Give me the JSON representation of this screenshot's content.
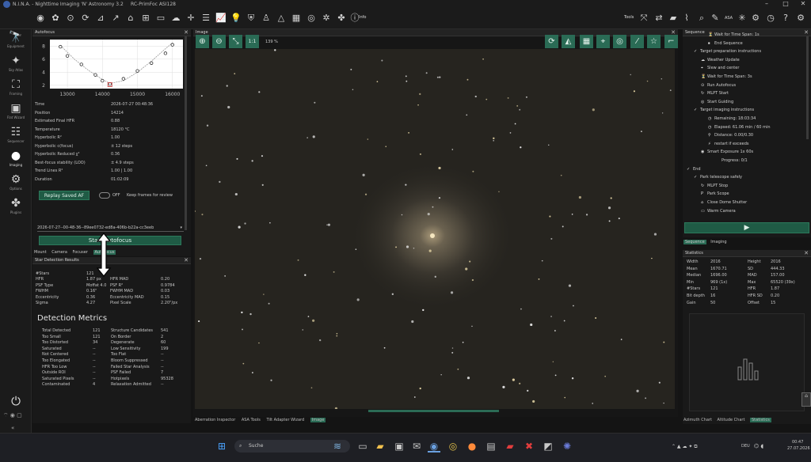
{
  "title": {
    "app": "N.I.N.A. - Nighttime Imaging 'N' Astronomy 3.2",
    "profile": "RC-PrimFoc ASI128"
  },
  "toolbar": {
    "info_label": "Info",
    "tools_label": "Tools"
  },
  "sidebar": {
    "items": [
      {
        "label": "Equipment"
      },
      {
        "label": "Sky Atlas"
      },
      {
        "label": "Framing"
      },
      {
        "label": "Flat Wizard"
      },
      {
        "label": "Sequencer"
      },
      {
        "label": "Imaging"
      },
      {
        "label": "Options"
      },
      {
        "label": "Plugins"
      }
    ]
  },
  "autofocus": {
    "title": "Autofocus",
    "chart": {
      "x_ticks": [
        "13000",
        "14000",
        "15000",
        "16000"
      ],
      "y_ticks": [
        "8",
        "6",
        "4",
        "2"
      ],
      "points": [
        [
          12800,
          7.9
        ],
        [
          13000,
          6.5
        ],
        [
          13400,
          5.2
        ],
        [
          13800,
          3.6
        ],
        [
          14000,
          2.7
        ],
        [
          14214,
          2.2
        ],
        [
          14600,
          3.0
        ],
        [
          15000,
          4.2
        ],
        [
          15400,
          5.4
        ],
        [
          15800,
          6.9
        ],
        [
          16000,
          8.2
        ]
      ],
      "curve": [
        [
          12800,
          8.1
        ],
        [
          13200,
          6.0
        ],
        [
          13600,
          4.3
        ],
        [
          14000,
          2.9
        ],
        [
          14214,
          2.3
        ],
        [
          14600,
          2.7
        ],
        [
          15000,
          4.0
        ],
        [
          15400,
          5.7
        ],
        [
          15800,
          7.6
        ],
        [
          16000,
          8.5
        ]
      ],
      "min_point": [
        14214,
        2.1
      ],
      "xlim": [
        12500,
        16300
      ],
      "ylim": [
        1.5,
        9
      ]
    },
    "details": [
      {
        "label": "Time",
        "value": "2026-07-27 00:48:36"
      },
      {
        "label": "Position",
        "value": "14214"
      },
      {
        "label": "Estimated Final HFR",
        "value": "0.88"
      },
      {
        "label": "Temperature",
        "value": "18120 °C"
      },
      {
        "label": "Hyperbolic R²",
        "value": "1.00"
      },
      {
        "label": "Hyperbolic c(focus)",
        "value": "± 12 steps"
      },
      {
        "label": "Hyperbolic Reduced χ²",
        "value": "0.36"
      },
      {
        "label": "Best-focus stability (LOO)",
        "value": "± 4.9 steps"
      },
      {
        "label": "Trend Lines R²",
        "value": "1.00 | 1.00"
      },
      {
        "label": "Duration",
        "value": "01:02:09"
      }
    ],
    "replay_label": "Replay Saved AF",
    "toggle_state": "OFF",
    "keep_frames_label": "Keep frames for review",
    "selected_run": "2026-07-27--00-48-36--89ee0732-ed8a-406b-b22a-cc3eeb",
    "start_label": "Start Autofocus",
    "tabs": [
      "Mount",
      "Camera",
      "Focuser",
      "Autofocus"
    ]
  },
  "detection": {
    "title": "Star Detection Results",
    "rows": [
      {
        "l1": "#Stars",
        "v1": "121",
        "l2": "",
        "v2": ""
      },
      {
        "l1": "HFR",
        "v1": "1.87 px",
        "l2": "HFR MAD",
        "v2": "0.20"
      },
      {
        "l1": "PSF Type",
        "v1": "Moffat 4.0",
        "l2": "PSF R²",
        "v2": "0.9784"
      },
      {
        "l1": "FWHM",
        "v1": "0.16\"",
        "l2": "FWHM MAD",
        "v2": "0.03"
      },
      {
        "l1": "Eccentricity",
        "v1": "0.36",
        "l2": "Eccentricity MAD",
        "v2": "0.15"
      },
      {
        "l1": "Sigma",
        "v1": "4.27",
        "l2": "Pixel Scale",
        "v2": "2.20\"/px"
      }
    ],
    "metrics_title": "Detection Metrics",
    "metrics": [
      {
        "l1": "Total Detected",
        "v1": "121",
        "l2": "Structure Candidates",
        "v2": "541"
      },
      {
        "l1": "Too Small",
        "v1": "121",
        "l2": "On Border",
        "v2": "2"
      },
      {
        "l1": "Too Distorted",
        "v1": "34",
        "l2": "Degenerate",
        "v2": "60"
      },
      {
        "l1": "Saturated",
        "v1": "--",
        "l2": "Low Sensitivity",
        "v2": "199"
      },
      {
        "l1": "Not Centered",
        "v1": "--",
        "l2": "Too Flat",
        "v2": "--"
      },
      {
        "l1": "Too Elongated",
        "v1": "--",
        "l2": "Bloom Suppressed",
        "v2": "--"
      },
      {
        "l1": "HFR Too Low",
        "v1": "--",
        "l2": "Failed Star Analysis",
        "v2": "--"
      },
      {
        "l1": "Outside ROI",
        "v1": "--",
        "l2": "PSF Failed",
        "v2": "7"
      },
      {
        "l1": "Saturated Pixels",
        "v1": "--",
        "l2": "Hotpixels",
        "v2": "95328"
      },
      {
        "l1": "Contaminated",
        "v1": "4",
        "l2": "Relaxation Admitted",
        "v2": "--"
      }
    ]
  },
  "image": {
    "title": "Image",
    "one_to_one": "1:1",
    "zoom": "139 %",
    "bottom_tabs": [
      "Aberration Inspector",
      "ASA Tools",
      "Tilt Adapter Wizard",
      "Image"
    ]
  },
  "sequence": {
    "title": "Sequence",
    "items": [
      {
        "indent": 3,
        "icon": "⏳",
        "text": "Wait for Time Span: 1s"
      },
      {
        "indent": 3,
        "icon": "⏹",
        "text": "End Sequence"
      },
      {
        "indent": 1,
        "icon": "✓",
        "text": "Target preparation instructions"
      },
      {
        "indent": 2,
        "icon": "☁",
        "text": "Weather Update"
      },
      {
        "indent": 2,
        "icon": "⌖",
        "text": "Slew and center"
      },
      {
        "indent": 2,
        "icon": "⏳",
        "text": "Wait for Time Span: 3s"
      },
      {
        "indent": 2,
        "icon": "⊙",
        "text": "Run Autofocus"
      },
      {
        "indent": 2,
        "icon": "↻",
        "text": "MLPT Start"
      },
      {
        "indent": 2,
        "icon": "◎",
        "text": "Start Guiding"
      },
      {
        "indent": 1,
        "icon": "✓",
        "text": "Target imaging instructions"
      },
      {
        "indent": 3,
        "icon": "◷",
        "text": "Remaining: 18:03:34"
      },
      {
        "indent": 3,
        "icon": "◷",
        "text": "Elapsed: 61.06 min / 60 min"
      },
      {
        "indent": 3,
        "icon": "⚲",
        "text": "Distance: 0.00/0.30"
      },
      {
        "indent": 3,
        "icon": "⚡",
        "text": "restart if exceeds"
      },
      {
        "indent": 2,
        "icon": "◉",
        "text": "Smart Exposure  1x  60s"
      },
      {
        "indent": 4,
        "icon": "",
        "text": "Progress: 0/1"
      },
      {
        "indent": 0,
        "icon": "✓",
        "text": "End"
      },
      {
        "indent": 1,
        "icon": "✓",
        "text": "Park telescope safely"
      },
      {
        "indent": 2,
        "icon": "↻",
        "text": "MLPT Stop"
      },
      {
        "indent": 2,
        "icon": "P",
        "text": "Park Scope"
      },
      {
        "indent": 2,
        "icon": "⌂",
        "text": "Close Dome Shutter"
      },
      {
        "indent": 2,
        "icon": "▭",
        "text": "Warm Camera"
      }
    ],
    "tabs": [
      "Sequence",
      "Imaging"
    ]
  },
  "statistics": {
    "title": "Statistics",
    "rows": [
      {
        "l1": "Width",
        "v1": "2016",
        "l2": "Height",
        "v2": "2016"
      },
      {
        "l1": "Mean",
        "v1": "1670.71",
        "l2": "SD",
        "v2": "444.33"
      },
      {
        "l1": "Median",
        "v1": "1696.00",
        "l2": "MAD",
        "v2": "157.00"
      },
      {
        "l1": "Min",
        "v1": "969 (1x)",
        "l2": "Max",
        "v2": "65520 (39x)"
      },
      {
        "l1": "#Stars",
        "v1": "121",
        "l2": "HFR",
        "v2": "1.87"
      },
      {
        "l1": "Bit depth",
        "v1": "16",
        "l2": "HFR SD",
        "v2": "0.20"
      },
      {
        "l1": "Gain",
        "v1": "50",
        "l2": "Offset",
        "v2": "15"
      }
    ],
    "bottom_tabs": [
      "Azimuth Chart",
      "Altitude Chart",
      "Statistics"
    ]
  },
  "taskbar": {
    "search_placeholder": "Suche",
    "language": "DEU",
    "time": "00:47",
    "date": "27.07.2026"
  }
}
